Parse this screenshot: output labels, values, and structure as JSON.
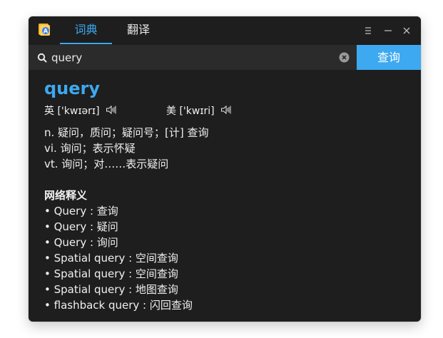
{
  "titlebar": {
    "tabs": [
      {
        "label": "词典",
        "active": true
      },
      {
        "label": "翻译",
        "active": false
      }
    ]
  },
  "search": {
    "value": "query",
    "button_label": "查询"
  },
  "entry": {
    "word": "query",
    "phonetics": {
      "uk": {
        "label": "英",
        "ipa": "['kwɪərɪ]"
      },
      "us": {
        "label": "美",
        "ipa": "['kwɪri]"
      }
    },
    "definitions": [
      "n. 疑问，质问；疑问号；[计] 查询",
      "vi. 询问；表示怀疑",
      "vt. 询问；对……表示疑问"
    ],
    "web_title": "网络释义",
    "web_items": [
      "• Query : 查询",
      "• Query : 疑问",
      "• Query : 询问",
      "• Spatial query : 空间查询",
      "• Spatial query : 空间查询",
      "• Spatial query : 地图查询",
      "• flashback query : 闪回查询"
    ]
  },
  "colors": {
    "accent": "#3da9f0",
    "window_bg": "#1e1e1e",
    "searchbar_bg": "#2b2b2b",
    "text": "#f0f0f0"
  },
  "icons": {
    "app": "dictionary-app-icon",
    "search": "search-icon",
    "clear": "clear-icon",
    "speaker": "speaker-icon",
    "menu": "menu-icon",
    "minimize": "minimize-icon",
    "close": "close-icon"
  }
}
